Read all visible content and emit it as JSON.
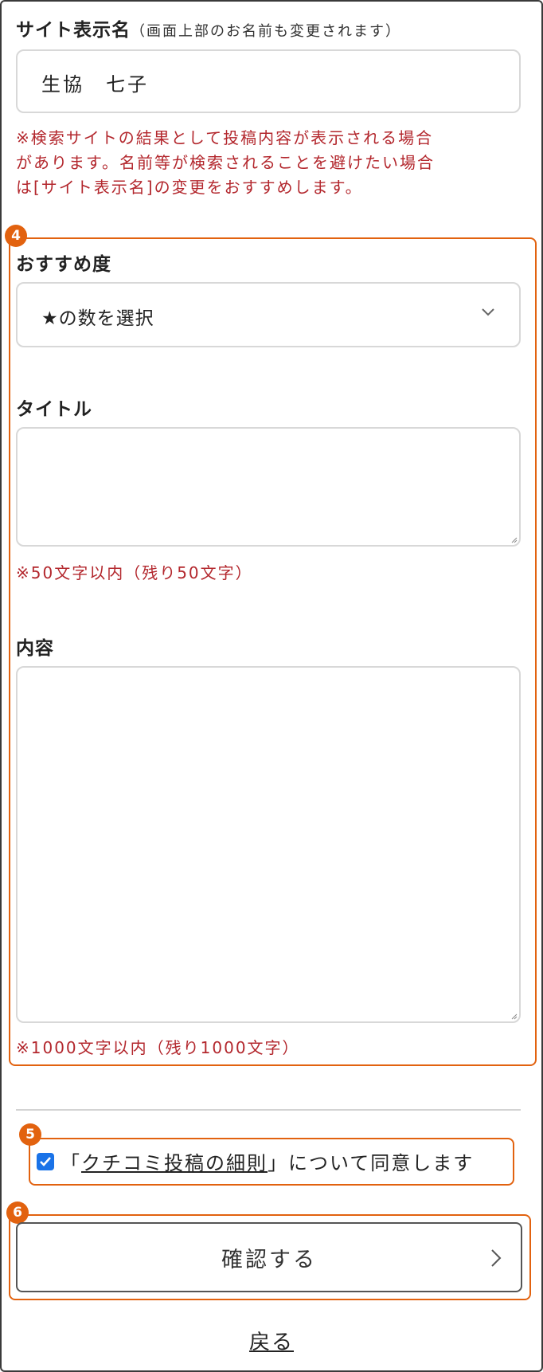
{
  "site_name": {
    "label": "サイト表示名",
    "label_note": "（画面上部のお名前も変更されます）",
    "value": "生協　七子",
    "warning_lines": [
      "※検索サイトの結果として投稿内容が表示される場合",
      "があります。名前等が検索されることを避けたい場合",
      "は[サイト表示名]の変更をおすすめします。"
    ]
  },
  "badges": {
    "review_fields": "4",
    "agree": "5",
    "confirm": "6"
  },
  "rating": {
    "label": "おすすめ度",
    "placeholder": "★の数を選択"
  },
  "title_field": {
    "label": "タイトル",
    "value": "",
    "limit_note": "※50文字以内（残り50文字）"
  },
  "content_field": {
    "label": "内容",
    "value": "",
    "limit_note": "※1000文字以内（残り1000文字）"
  },
  "agreement": {
    "open_bracket": "「",
    "link_text": "クチコミ投稿の細則",
    "close_bracket": "」",
    "suffix": "について同意します",
    "checked": true
  },
  "confirm_button": {
    "label": "確認する"
  },
  "back_link": {
    "label": "戻る"
  },
  "colors": {
    "accent_orange": "#e2620f",
    "warning_red": "#b3272d",
    "checkbox_blue": "#1a73e8"
  },
  "icons": {
    "select": "chevron-down-icon",
    "confirm": "chevron-right-icon",
    "checkbox": "check-icon"
  }
}
